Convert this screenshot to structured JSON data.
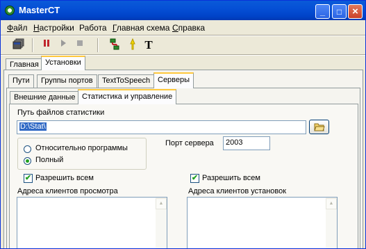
{
  "window": {
    "title": "MasterCT",
    "controls": {
      "minimize": "_",
      "maximize": "□",
      "close": "×"
    }
  },
  "menu": [
    {
      "label": "Файл",
      "underline": "Ф",
      "rest": "айл"
    },
    {
      "label": "Настройки",
      "underline": "Н",
      "rest": "астройки"
    },
    {
      "label": "Работа",
      "underline": "",
      "rest": "Работа"
    },
    {
      "label": "Главная схема",
      "underline": "Г",
      "rest": "лавная схема"
    },
    {
      "label": "Справка",
      "underline": "С",
      "rest": "правка"
    }
  ],
  "toolbar": {
    "icons": [
      "windows-icon",
      "pause-icon",
      "play-icon",
      "stop-icon",
      "network-icon",
      "bulb-icon",
      "text-icon"
    ],
    "text_tool_glyph": "T"
  },
  "main_tabs": [
    "Главная",
    "Установки"
  ],
  "settings_tabs": [
    "Пути",
    "Группы портов",
    "TextToSpeech",
    "Серверы"
  ],
  "server_tabs": [
    "Внешние данные",
    "Статистика и управление"
  ],
  "stats": {
    "path_label": "Путь файлов статистики",
    "path_value": "D:\\Stat\\",
    "path_options": [
      "Относительно программы",
      "Полный"
    ],
    "selected_option": "Полный",
    "port_label": "Порт сервера",
    "port_value": "2003",
    "allow_all_label": "Разрешить всем",
    "view_clients_label": "Адреса клиентов просмотра",
    "install_clients_label": "Адреса клиентов установок"
  },
  "colors": {
    "titlebar": "#0550d6",
    "selection": "#316ac5",
    "tab_highlight": "#ffc83c",
    "check_mark": "#21a121"
  }
}
